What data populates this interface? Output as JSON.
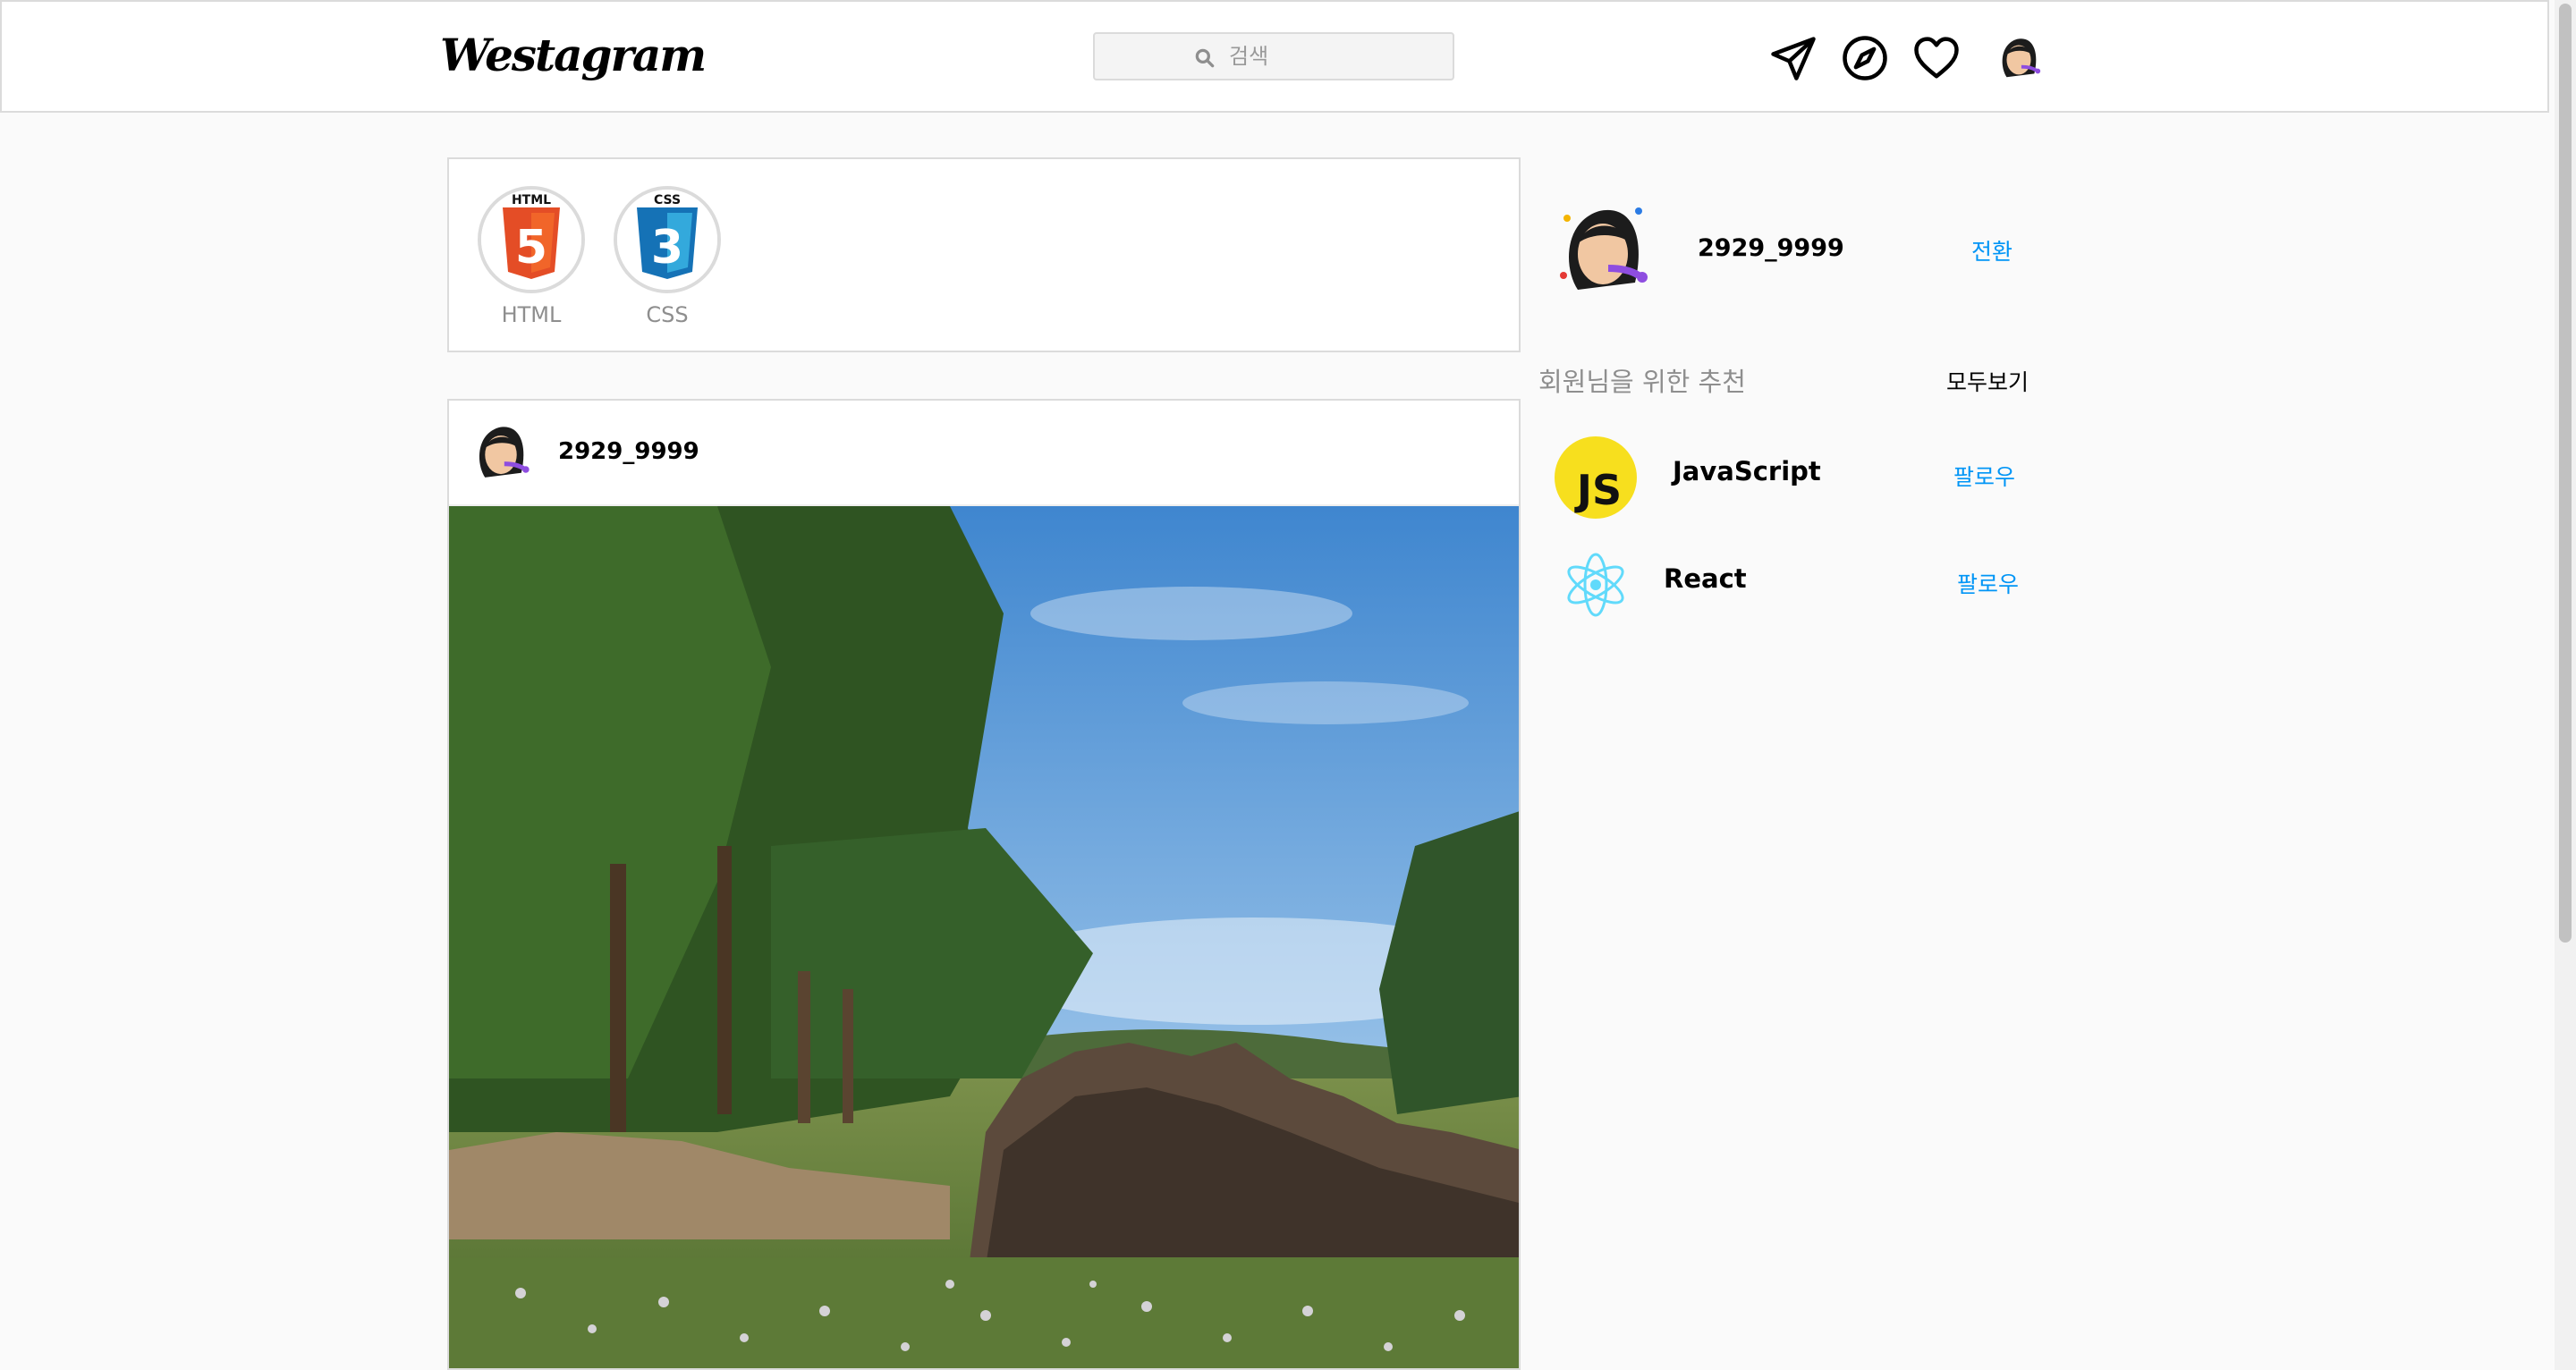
{
  "nav": {
    "logo": "Westagram",
    "search_placeholder": "검색",
    "icons": [
      "paper-plane-icon",
      "compass-icon",
      "heart-icon",
      "profile-avatar"
    ]
  },
  "stories": [
    {
      "label": "HTML",
      "icon": "html5-logo"
    },
    {
      "label": "CSS",
      "icon": "css3-logo"
    }
  ],
  "post": {
    "username": "2929_9999"
  },
  "sidebar": {
    "username": "2929_9999",
    "switch_label": "전환",
    "recommend_title": "회원님을 위한 추천",
    "see_all_label": "모두보기",
    "recommendations": [
      {
        "name": "JavaScript",
        "follow_label": "팔로우",
        "icon": "javascript-logo"
      },
      {
        "name": "React",
        "follow_label": "팔로우",
        "icon": "react-logo"
      }
    ]
  },
  "colors": {
    "link": "#0095f6",
    "border": "#dbdbdb",
    "background": "#fafafa"
  }
}
